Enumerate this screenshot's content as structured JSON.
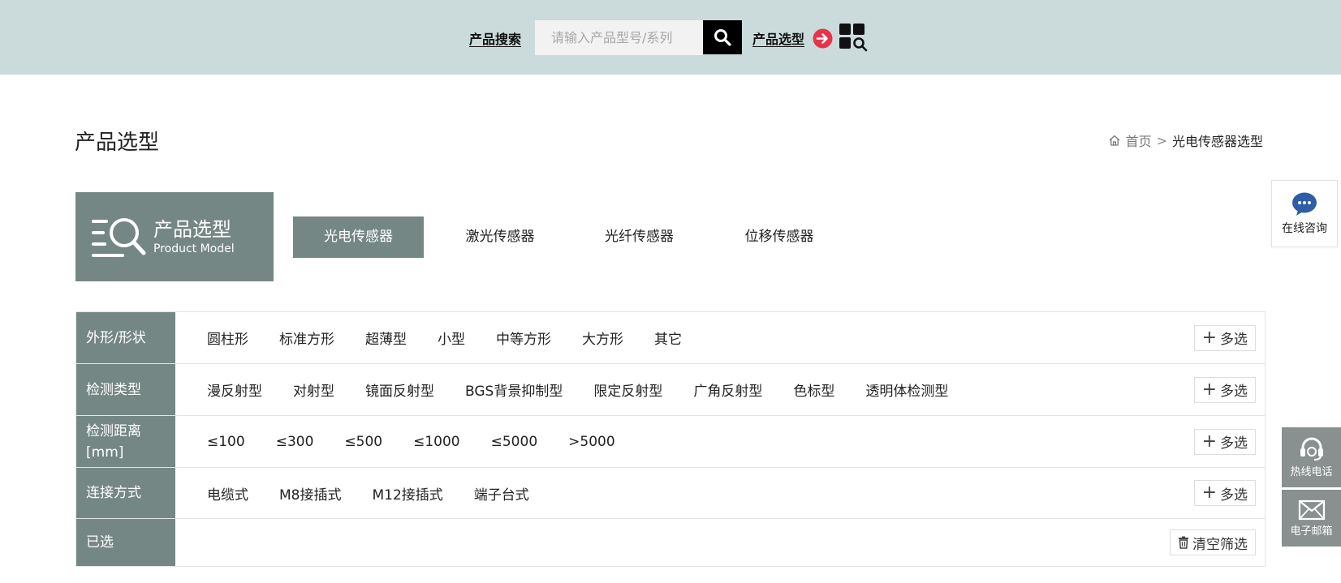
{
  "topbar": {
    "search_label": "产品搜索",
    "search_placeholder": "请输入产品型号/系列",
    "select_label": "产品选型"
  },
  "page": {
    "title": "产品选型",
    "breadcrumb": {
      "home": "首页",
      "separator": ">",
      "current": "光电传感器选型"
    }
  },
  "model_box": {
    "title": "产品选型",
    "subtitle": "Product Model"
  },
  "tabs": [
    {
      "label": "光电传感器",
      "active": true
    },
    {
      "label": "激光传感器",
      "active": false
    },
    {
      "label": "光纤传感器",
      "active": false
    },
    {
      "label": "位移传感器",
      "active": false
    }
  ],
  "filters": [
    {
      "header": "外形/形状",
      "options": [
        "圆柱形",
        "标准方形",
        "超薄型",
        "小型",
        "中等方形",
        "大方形",
        "其它"
      ],
      "action": "多选"
    },
    {
      "header": "检测类型",
      "options": [
        "漫反射型",
        "对射型",
        "镜面反射型",
        "BGS背景抑制型",
        "限定反射型",
        "广角反射型",
        "色标型",
        "透明体检测型"
      ],
      "action": "多选"
    },
    {
      "header": "检测距离[mm]",
      "options": [
        "≤100",
        "≤300",
        "≤500",
        "≤1000",
        "≤5000",
        ">5000"
      ],
      "action": "多选"
    },
    {
      "header": "连接方式",
      "options": [
        "电缆式",
        "M8接插式",
        "M12接插式",
        "端子台式"
      ],
      "action": "多选"
    }
  ],
  "selected_row": {
    "header": "已选",
    "clear_label": "清空筛选"
  },
  "side_widgets": {
    "consult_label": "在线咨询",
    "hotline_label": "热线电话",
    "email_label": "电子邮箱"
  },
  "colors": {
    "topbar_bg": "#cbdbdb",
    "accent": "#758784",
    "arrow_red": "#e8334a"
  }
}
